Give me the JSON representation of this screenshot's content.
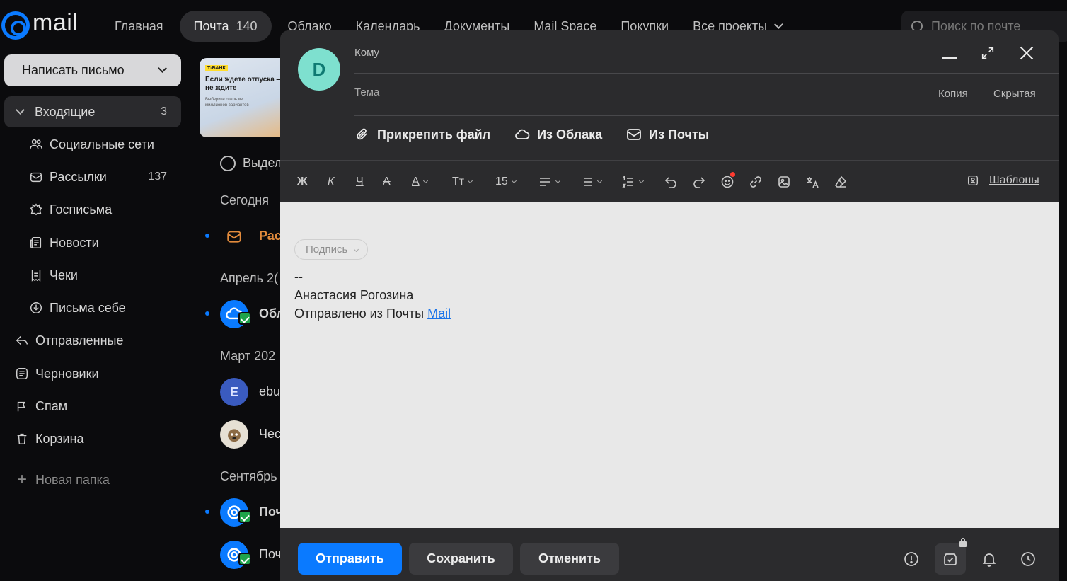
{
  "topbar": {
    "logo_text": "mail",
    "nav": [
      {
        "label": "Главная"
      },
      {
        "label": "Почта",
        "count": "140"
      },
      {
        "label": "Облако"
      },
      {
        "label": "Календарь"
      },
      {
        "label": "Документы"
      },
      {
        "label": "Mail Space"
      },
      {
        "label": "Покупки"
      },
      {
        "label": "Все проекты"
      }
    ],
    "search_placeholder": "Поиск по почте"
  },
  "sidebar": {
    "compose_label": "Написать письмо",
    "inbox": {
      "label": "Входящие",
      "count": "3"
    },
    "subfolders": [
      {
        "label": "Социальные сети",
        "icon": "people-icon",
        "count": ""
      },
      {
        "label": "Рассылки",
        "icon": "newsletter-icon",
        "count": "137"
      },
      {
        "label": "Госписьма",
        "icon": "emblem-icon",
        "count": ""
      },
      {
        "label": "Новости",
        "icon": "news-icon",
        "count": ""
      },
      {
        "label": "Чеки",
        "icon": "receipt-icon",
        "count": ""
      },
      {
        "label": "Письма себе",
        "icon": "self-mail-icon",
        "count": ""
      }
    ],
    "folders": [
      {
        "label": "Отправленные",
        "icon": "sent-icon"
      },
      {
        "label": "Черновики",
        "icon": "drafts-icon"
      },
      {
        "label": "Спам",
        "icon": "spam-icon"
      },
      {
        "label": "Корзина",
        "icon": "trash-icon"
      }
    ],
    "new_folder": "Новая папка"
  },
  "messages": {
    "promo": {
      "bank": "Т-БАНК",
      "title": "Если ждете отпуска — не ждите",
      "sub": "Выберите отель из миллионов вариантов"
    },
    "select_label": "Выдел",
    "groups": [
      {
        "heading": "Сегодня"
      },
      {
        "heading": "Апрель 2("
      },
      {
        "heading": "Март 202"
      },
      {
        "heading": "Сентябрь"
      }
    ],
    "rows": [
      {
        "sender": "Рас",
        "avatar": "envelope"
      },
      {
        "sender": "Обл",
        "avatar": "cloud"
      },
      {
        "sender": "ebu",
        "avatar": "E"
      },
      {
        "sender": "Чес",
        "avatar": "dog"
      },
      {
        "sender": "Поч",
        "avatar": "mail"
      },
      {
        "sender": "Поч",
        "avatar": "mail"
      }
    ]
  },
  "compose": {
    "avatar_letter": "D",
    "to_label": "Кому",
    "subject_label": "Тема",
    "cc_label": "Копия",
    "bcc_label": "Скрытая",
    "attach_file": "Прикрепить файл",
    "from_cloud": "Из Облака",
    "from_mail": "Из Почты",
    "toolbar": {
      "bold": "Ж",
      "italic": "К",
      "underline": "Ч",
      "strike": "А",
      "color": "А",
      "font_size_label": "Тт",
      "font_size_value": "15",
      "templates": "Шаблоны"
    },
    "signature": {
      "pill": "Подпись",
      "dash": "--",
      "name": "Анастасия Рогозина",
      "sent_from": "Отправлено из Почты",
      "link": "Mail"
    },
    "footer": {
      "send": "Отправить",
      "save": "Сохранить",
      "cancel": "Отменить"
    }
  },
  "colors": {
    "accent": "#0a7aff",
    "avatar_bg": "#7ee0cf",
    "background": "#0b0b0d",
    "compose_bg": "#2b2b2d",
    "editor_bg": "#e8e8e8"
  }
}
